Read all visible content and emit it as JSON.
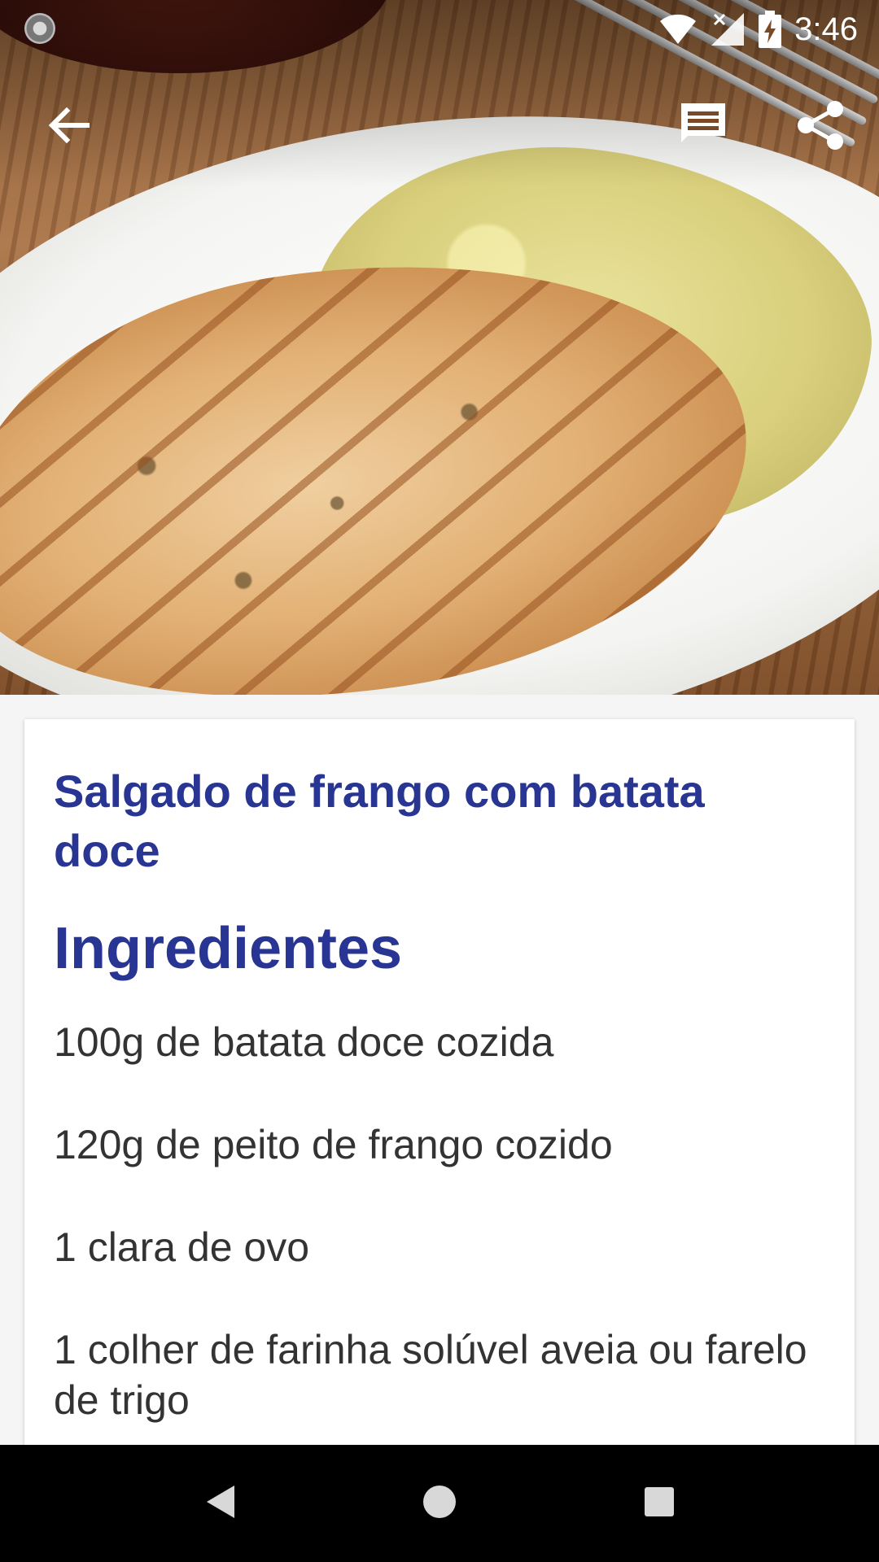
{
  "status_bar": {
    "time": "3:46",
    "icons": [
      "loading-indicator-icon",
      "wifi-icon",
      "cell-signal-no-data-icon",
      "battery-charging-icon"
    ]
  },
  "toolbar": {
    "back_icon": "arrow-back-icon",
    "comments_icon": "comments-icon",
    "share_icon": "share-icon"
  },
  "hero": {
    "image_subject": "grilled chicken breast with mashed sweet potato on white plate"
  },
  "recipe": {
    "title": "Salgado de frango com batata doce",
    "section_title": "Ingredientes",
    "ingredients": [
      "100g de batata doce cozida",
      "120g de peito de frango cozido",
      "1 clara de ovo",
      "1 colher de farinha solúvel aveia ou farelo de trigo"
    ]
  },
  "nav_bar": {
    "icons": [
      "nav-back-icon",
      "nav-home-icon",
      "nav-recents-icon"
    ]
  },
  "colors": {
    "title": "#283593",
    "body_text": "#333333",
    "page_background": "#f5f5f5",
    "card_background": "#ffffff",
    "nav_bar": "#000000"
  }
}
